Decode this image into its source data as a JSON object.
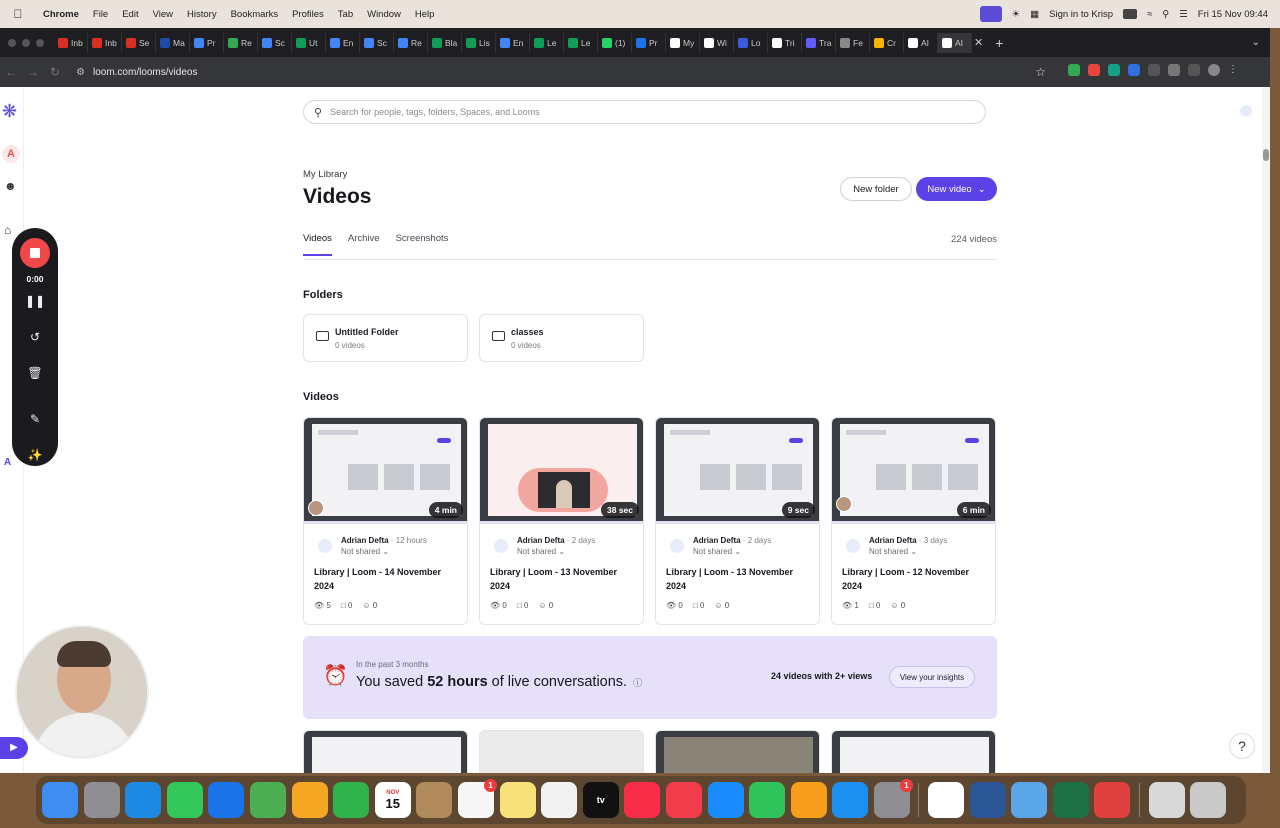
{
  "menubar": {
    "app_name": "Chrome",
    "items": [
      "File",
      "Edit",
      "View",
      "History",
      "Bookmarks",
      "Profiles",
      "Tab",
      "Window",
      "Help"
    ],
    "krisp": "Sign in to Krisp",
    "clock": "Fri 15 Nov  09:44"
  },
  "browser": {
    "tabs": [
      {
        "label": "Inb",
        "color": "#d93025"
      },
      {
        "label": "Inb",
        "color": "#d93025"
      },
      {
        "label": "Se",
        "color": "#d93025"
      },
      {
        "label": "Ma",
        "color": "#1f4aa8"
      },
      {
        "label": "Pr",
        "color": "#4285f4"
      },
      {
        "label": "Re",
        "color": "#34a853"
      },
      {
        "label": "Sc",
        "color": "#4285f4"
      },
      {
        "label": "Ut",
        "color": "#0f9d58"
      },
      {
        "label": "En",
        "color": "#4285f4"
      },
      {
        "label": "Sc",
        "color": "#4285f4"
      },
      {
        "label": "Re",
        "color": "#4285f4"
      },
      {
        "label": "Bla",
        "color": "#0f9d58"
      },
      {
        "label": "Lis",
        "color": "#0f9d58"
      },
      {
        "label": "En",
        "color": "#4285f4"
      },
      {
        "label": "Le",
        "color": "#0f9d58"
      },
      {
        "label": "Le",
        "color": "#0f9d58"
      },
      {
        "label": "(1)",
        "color": "#25d366"
      },
      {
        "label": "Pr",
        "color": "#1a73e8"
      },
      {
        "label": "My",
        "color": "#ffffff"
      },
      {
        "label": "Wi",
        "color": "#ffffff"
      },
      {
        "label": "Lo",
        "color": "#3b5bdb"
      },
      {
        "label": "Tri",
        "color": "#ffffff"
      },
      {
        "label": "Tra",
        "color": "#635bff"
      },
      {
        "label": "Fe",
        "color": "#888888"
      },
      {
        "label": "Cr",
        "color": "#f4b400"
      },
      {
        "label": "AI",
        "color": "#ffffff"
      },
      {
        "label": "AI",
        "color": "#ffffff"
      }
    ],
    "url": "loom.com/looms/videos"
  },
  "search": {
    "placeholder": "Search for people, tags, folders, Spaces, and Looms"
  },
  "header": {
    "breadcrumb": "My Library",
    "title": "Videos",
    "new_folder": "New folder",
    "new_video": "New video"
  },
  "tabs": [
    "Videos",
    "Archive",
    "Screenshots"
  ],
  "video_count": "224 videos",
  "folders_heading": "Folders",
  "folders": [
    {
      "name": "Untitled Folder",
      "count": "0 videos"
    },
    {
      "name": "classes",
      "count": "0 videos"
    }
  ],
  "videos_heading": "Videos",
  "videos": [
    {
      "duration": "4 min",
      "author": "Adrian Defta",
      "age": "12 hours",
      "shared": "Not shared",
      "title": "Library | Loom - 14 November 2024",
      "views": "5",
      "comments": "0",
      "reactions": "0"
    },
    {
      "duration": "38 sec",
      "author": "Adrian Defta",
      "age": "2 days",
      "shared": "Not shared",
      "title": "Library | Loom - 13 November 2024",
      "views": "0",
      "comments": "0",
      "reactions": "0"
    },
    {
      "duration": "9 sec",
      "author": "Adrian Defta",
      "age": "2 days",
      "shared": "Not shared",
      "title": "Library | Loom - 13 November 2024",
      "views": "0",
      "comments": "0",
      "reactions": "0"
    },
    {
      "duration": "6 min",
      "author": "Adrian Defta",
      "age": "3 days",
      "shared": "Not shared",
      "title": "Library | Loom - 12 November 2024",
      "views": "1",
      "comments": "0",
      "reactions": "0"
    }
  ],
  "insight": {
    "period": "In the past 3 months",
    "prefix": "You saved ",
    "hours": "52 hours",
    "suffix": " of live conversations.",
    "views_text": "24 videos with 2+ views",
    "button": "View your insights"
  },
  "recorder": {
    "time": "0:00"
  },
  "dock": {
    "calendar_month": "NOV",
    "calendar_day": "15",
    "badge_reminders": "1",
    "badge_settings": "1",
    "tv_label": "tv"
  },
  "colors": {
    "accent": "#5b42e6",
    "record": "#f04848",
    "insight_bg": "#e6e0fb"
  }
}
